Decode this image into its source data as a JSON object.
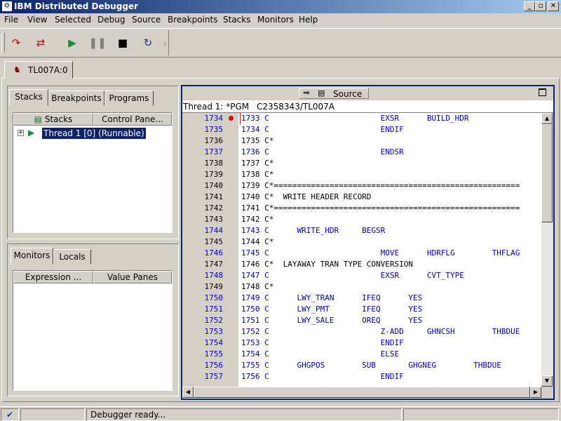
{
  "window": {
    "title": "IBM Distributed Debugger"
  },
  "menu": [
    "File",
    "View",
    "Selected",
    "Debug",
    "Source",
    "Breakpoints",
    "Stacks",
    "Monitors",
    "Help"
  ],
  "session_tab": "TL007A:0",
  "stacks_panel": {
    "tabs": [
      "Stacks",
      "Breakpoints",
      "Programs"
    ],
    "columns": [
      "Stacks",
      "Control Pane..."
    ],
    "thread": "Thread 1 [0] (Runnable)"
  },
  "monitors_panel": {
    "tabs": [
      "Monitors",
      "Locals"
    ],
    "columns": [
      "Expression ...",
      "Value Panes"
    ]
  },
  "source": {
    "title": "Source",
    "thread_label": "Thread 1: *PGM",
    "program": "C2358343/TL007A",
    "lines": [
      {
        "n": "1734",
        "t": "1733 C                        EXSR      BUILD_HDR",
        "exec": true,
        "bp": true
      },
      {
        "n": "1735",
        "t": "1734 C                        ENDIF",
        "exec": true
      },
      {
        "n": "1736",
        "t": "1735 C*",
        "exec": false
      },
      {
        "n": "1737",
        "t": "1736 C                        ENDSR",
        "exec": true
      },
      {
        "n": "1738",
        "t": "1737 C*",
        "exec": false
      },
      {
        "n": "1739",
        "t": "1738 C*",
        "exec": false
      },
      {
        "n": "1740",
        "t": "1739 C*=====================================================",
        "exec": false
      },
      {
        "n": "1741",
        "t": "1740 C*  WRITE HEADER RECORD",
        "exec": false
      },
      {
        "n": "1742",
        "t": "1741 C*=====================================================",
        "exec": false
      },
      {
        "n": "1743",
        "t": "1742 C*",
        "exec": false
      },
      {
        "n": "1744",
        "t": "1743 C      WRITE_HDR     BEGSR",
        "exec": true
      },
      {
        "n": "1745",
        "t": "1744 C*",
        "exec": false
      },
      {
        "n": "1746",
        "t": "1745 C                        MOVE      HDRFLG        THFLAG",
        "exec": true
      },
      {
        "n": "1747",
        "t": "1746 C*  LAYAWAY TRAN TYPE CONVERSION",
        "exec": false
      },
      {
        "n": "1748",
        "t": "1747 C                        EXSR      CVT_TYPE",
        "exec": true
      },
      {
        "n": "1749",
        "t": "1748 C*",
        "exec": false
      },
      {
        "n": "1750",
        "t": "1749 C      LWY_TRAN      IFEQ      YES",
        "exec": true
      },
      {
        "n": "1751",
        "t": "1750 C      LWY_PMT       IFEQ      YES",
        "exec": true
      },
      {
        "n": "1752",
        "t": "1751 C      LWY_SALE      OREQ      YES",
        "exec": true
      },
      {
        "n": "1753",
        "t": "1752 C                        Z-ADD     GHNCSH        THBDUE",
        "exec": true
      },
      {
        "n": "1754",
        "t": "1753 C                        ENDIF",
        "exec": true
      },
      {
        "n": "1755",
        "t": "1754 C                        ELSE",
        "exec": true
      },
      {
        "n": "1756",
        "t": "1755 C      GHGPOS        SUB       GHGNEG        THBDUE",
        "exec": true
      },
      {
        "n": "1757",
        "t": "1756 C                        ENDIF",
        "exec": true
      }
    ]
  },
  "status": {
    "message": "Debugger ready..."
  },
  "colors": {
    "title_start": "#0a246a",
    "title_end": "#a6caf0",
    "exec_line": "#0000cc",
    "breakpoint": "#dd0000"
  }
}
